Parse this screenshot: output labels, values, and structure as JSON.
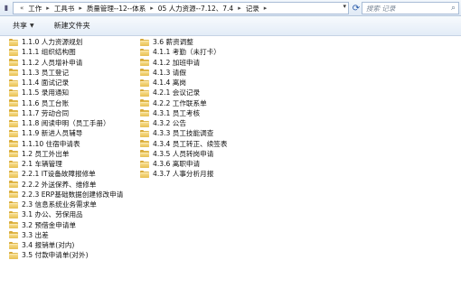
{
  "address": {
    "crumbs": [
      "工作",
      "工具书",
      "质量管理--12--体系",
      "05 人力资源--7.12、7.4",
      "记录"
    ],
    "separator": "▸"
  },
  "search": {
    "placeholder": "搜索 记录"
  },
  "toolbar": {
    "share_label": "共享",
    "new_folder_label": "新建文件夹"
  },
  "folders": {
    "column1": [
      "1.1.0 人力资源规划",
      "1.1.1 组织结构图",
      "1.1.2 人员增补申请",
      "1.1.3 员工登记",
      "1.1.4 面试记录",
      "1.1.5 录用通知",
      "1.1.6 员工台账",
      "1.1.7 劳动合同",
      "1.1.8 阅读申明（员工手册）",
      "1.1.9 新进人员辅导",
      "1.1.10 住宿申请表",
      "1.2 员工外出单",
      "2.1 车辆管理",
      "2.2.1 IT设备故障报修单",
      "2.2.2 外送保养、维修单",
      "2.2.3 ERP基础数据创建修改申请",
      "2.3 信息系统业务需求单",
      "3.1 办公、劳保用品",
      "3.2 预借金申请单",
      "3.3 出差",
      "3.4 报销单(对内)",
      "3.5 付款申请单(对外)"
    ],
    "column2": [
      "3.6 薪资调整",
      "4.1.1 考勤（未打卡）",
      "4.1.2 加班申请",
      "4.1.3 请假",
      "4.1.4 离岗",
      "4.2.1 会议记录",
      "4.2.2 工作联系单",
      "4.3.1 员工考核",
      "4.3.2 公告",
      "4.3.3 员工技能调查",
      "4.3.4 员工转正、续签表",
      "4.3.5 人员转岗申请",
      "4.3.6 离职申请",
      "4.3.7 人事分析月报"
    ]
  }
}
